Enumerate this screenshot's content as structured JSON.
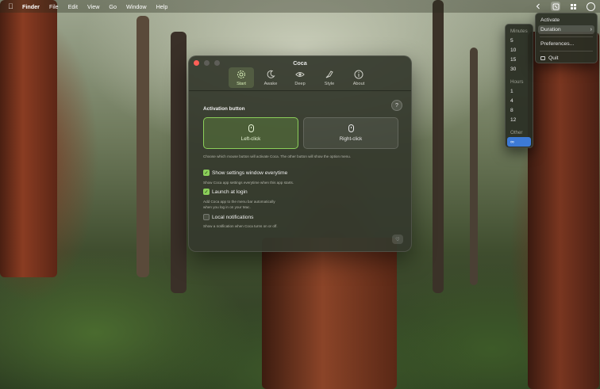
{
  "menubar": {
    "apple_icon": "apple-logo-icon",
    "items": [
      "Finder",
      "File",
      "Edit",
      "View",
      "Go",
      "Window",
      "Help"
    ]
  },
  "window": {
    "title": "Coca",
    "tabs": [
      {
        "label": "Start",
        "icon": "gear-icon",
        "active": true
      },
      {
        "label": "Awake",
        "icon": "moon-icon"
      },
      {
        "label": "Deep",
        "icon": "eye-icon"
      },
      {
        "label": "Style",
        "icon": "brush-icon"
      },
      {
        "label": "About",
        "icon": "info-icon"
      }
    ],
    "activation_label": "Activation button",
    "left_click": "Left-click",
    "right_click": "Right-click",
    "activation_hint": "Choose which mouse button will activate Coca. The other button will show the option menu.",
    "settings_label": "Show settings window everytime",
    "settings_hint": "Show Coca app settings everytime when this app starts.",
    "login_label": "Launch at login",
    "login_hint_1": "Add Coca app to the menu bar automatically",
    "login_hint_2": "when you log in on your Mac.",
    "notif_label": "Local notifications",
    "notif_hint": "Show a notification when Coca turns on or off."
  },
  "status_menu": {
    "items": [
      "Activate",
      "Duration",
      "Preferences...",
      "Quit"
    ]
  },
  "duration_menu": {
    "minutes_header": "Minutes",
    "minutes": [
      "5",
      "10",
      "15",
      "30"
    ],
    "hours_header": "Hours",
    "hours": [
      "1",
      "4",
      "8",
      "12"
    ],
    "other_header": "Other",
    "infinite": "∞"
  },
  "colors": {
    "accent_green": "#8bcf5a",
    "selection_blue": "#3d7ad6",
    "close_red": "#ff5f57"
  }
}
